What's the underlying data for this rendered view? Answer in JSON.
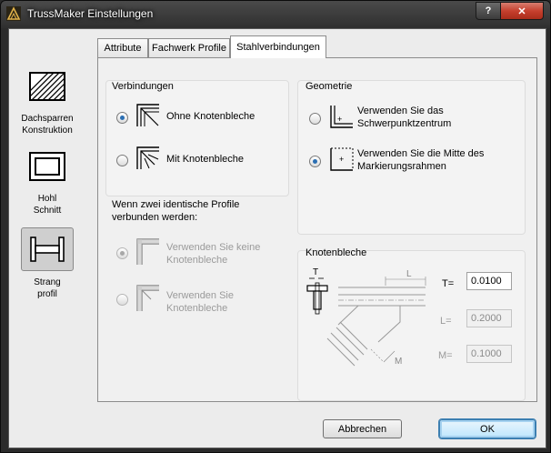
{
  "window": {
    "title": "TrussMaker Einstellungen",
    "help_label": "?",
    "close_label": "✕"
  },
  "sidebar": {
    "items": [
      {
        "label_line1": "Dachsparren",
        "label_line2": "Konstruktion",
        "icon": "hatched-rectangle-icon",
        "active": false
      },
      {
        "label_line1": "Hohl",
        "label_line2": "Schnitt",
        "icon": "hollow-section-icon",
        "active": false
      },
      {
        "label_line1": "Strang",
        "label_line2": "profil",
        "icon": "i-beam-profile-icon",
        "active": true
      }
    ]
  },
  "tabs": [
    {
      "label": "Attribute",
      "active": false
    },
    {
      "label": "Fachwerk Profile",
      "active": false
    },
    {
      "label": "Stahlverbindungen",
      "active": true
    }
  ],
  "verbindungen": {
    "title": "Verbindungen",
    "options": [
      {
        "label": "Ohne Knotenbleche",
        "checked": true
      },
      {
        "label": "Mit Knotenbleche",
        "checked": false
      }
    ]
  },
  "identische": {
    "question_line1": "Wenn zwei identische Profile",
    "question_line2": "verbunden werden:",
    "options": [
      {
        "label_line1": "Verwenden Sie keine",
        "label_line2": "Knotenbleche",
        "checked": true,
        "disabled": true
      },
      {
        "label_line1": "Verwenden Sie",
        "label_line2": "Knotenbleche",
        "checked": false,
        "disabled": true
      }
    ]
  },
  "geometrie": {
    "title": "Geometrie",
    "options": [
      {
        "label_line1": "Verwenden Sie das",
        "label_line2": "Schwerpunktzentrum",
        "checked": false
      },
      {
        "label_line1": "Verwenden Sie die Mitte des",
        "label_line2": "Markierungsrahmen",
        "checked": true
      }
    ]
  },
  "knotenbleche": {
    "title": "Knotenbleche",
    "diagram_labels": {
      "t": "T",
      "l": "L",
      "m": "M"
    },
    "fields": [
      {
        "label": "T=",
        "value": "0.0100",
        "disabled": false
      },
      {
        "label": "L=",
        "value": "0.2000",
        "disabled": true
      },
      {
        "label": "M=",
        "value": "0.1000",
        "disabled": true
      }
    ]
  },
  "footer": {
    "cancel_label": "Abbrechen",
    "ok_label": "OK"
  }
}
